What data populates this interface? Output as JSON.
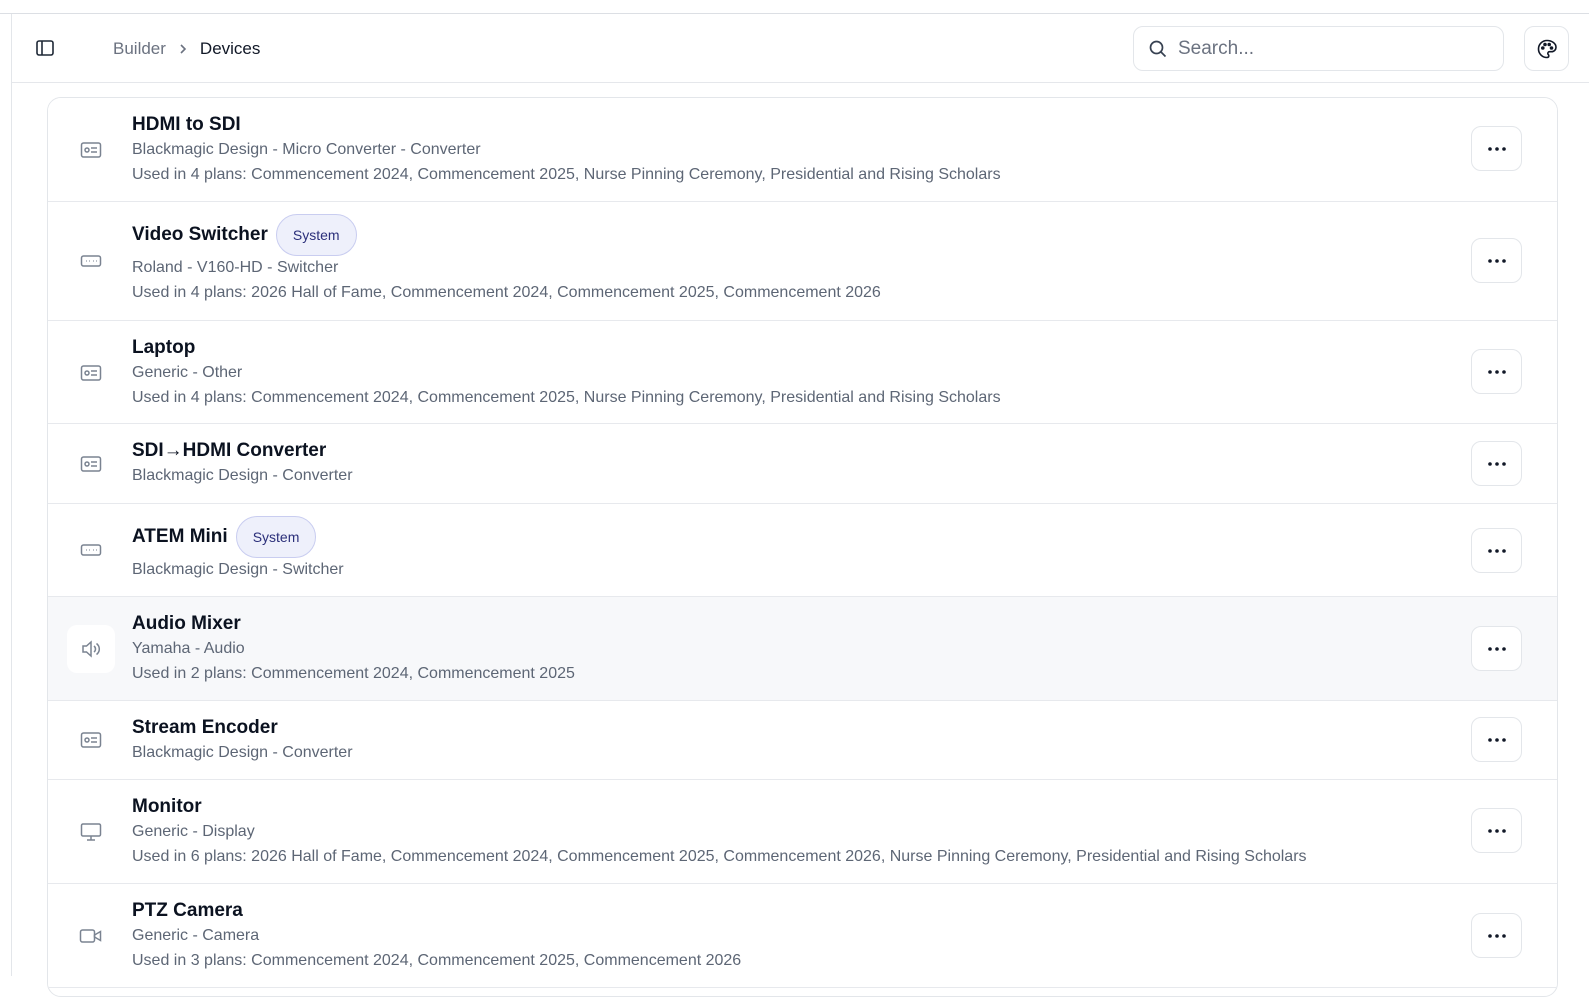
{
  "header": {
    "breadcrumb": {
      "parent": "Builder",
      "current": "Devices"
    },
    "search": {
      "placeholder": "Search..."
    }
  },
  "colors": {
    "badge_bg": "#eef0fb",
    "badge_text": "#2b2f7a",
    "accent": "#0b1220",
    "muted": "#5d6675"
  },
  "devices": [
    {
      "title": "HDMI to SDI",
      "badge": "",
      "subtitle": "Blackmagic Design - Micro Converter - Converter",
      "usage": "Used in 4 plans: Commencement 2024, Commencement 2025, Nurse Pinning Ceremony, Presidential and Rising Scholars",
      "icon": "id-card-icon"
    },
    {
      "title": "Video Switcher",
      "badge": "System",
      "subtitle": "Roland - V160-HD - Switcher",
      "usage": "Used in 4 plans: 2026 Hall of Fame, Commencement 2024, Commencement 2025, Commencement 2026",
      "icon": "switcher-icon"
    },
    {
      "title": "Laptop",
      "badge": "",
      "subtitle": "Generic - Other",
      "usage": "Used in 4 plans: Commencement 2024, Commencement 2025, Nurse Pinning Ceremony, Presidential and Rising Scholars",
      "icon": "id-card-icon"
    },
    {
      "title": "SDI→HDMI Converter",
      "badge": "",
      "subtitle": "Blackmagic Design - Converter",
      "usage": "",
      "icon": "id-card-icon"
    },
    {
      "title": "ATEM Mini",
      "badge": "System",
      "subtitle": "Blackmagic Design - Switcher",
      "usage": "",
      "icon": "switcher-icon"
    },
    {
      "title": "Audio Mixer",
      "badge": "",
      "subtitle": "Yamaha - Audio",
      "usage": "Used in 2 plans: Commencement 2024, Commencement 2025",
      "icon": "speaker-icon"
    },
    {
      "title": "Stream Encoder",
      "badge": "",
      "subtitle": "Blackmagic Design - Converter",
      "usage": "",
      "icon": "id-card-icon"
    },
    {
      "title": "Monitor",
      "badge": "",
      "subtitle": "Generic - Display",
      "usage": "Used in 6 plans: 2026 Hall of Fame, Commencement 2024, Commencement 2025, Commencement 2026, Nurse Pinning Ceremony, Presidential and Rising Scholars",
      "icon": "monitor-icon"
    },
    {
      "title": "PTZ Camera",
      "badge": "",
      "subtitle": "Generic - Camera",
      "usage": "Used in 3 plans: Commencement 2024, Commencement 2025, Commencement 2026",
      "icon": "video-camera-icon"
    }
  ]
}
